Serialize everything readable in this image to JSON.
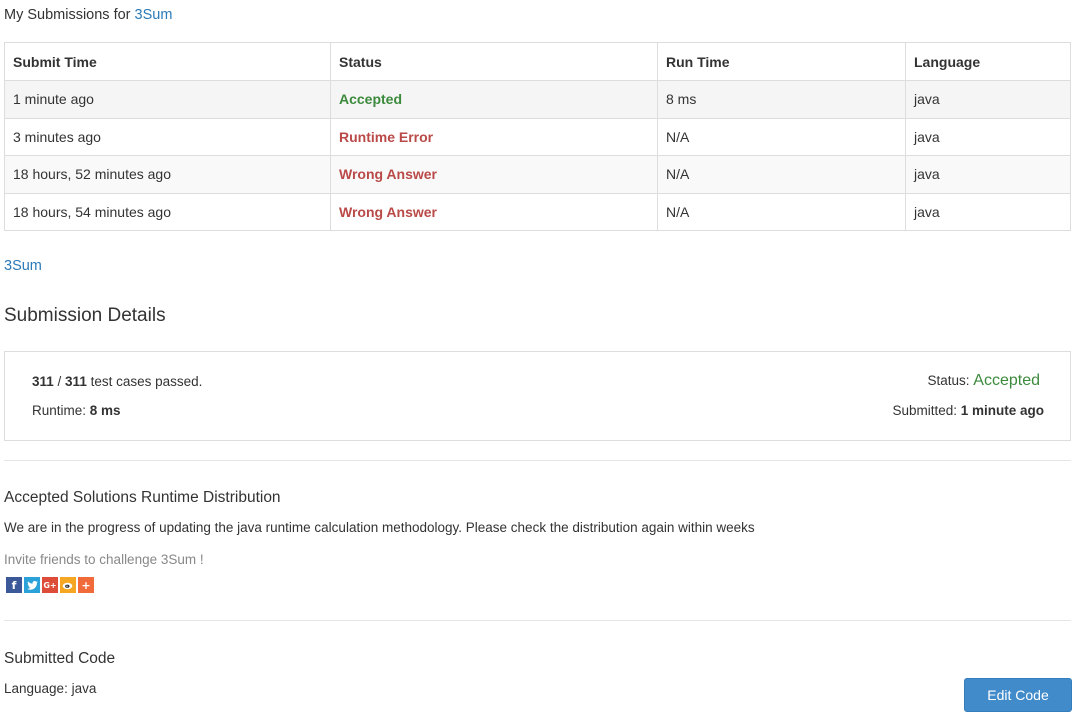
{
  "header": {
    "prefix": "My Submissions for ",
    "problem_link": "3Sum"
  },
  "submissions": {
    "columns": [
      "Submit Time",
      "Status",
      "Run Time",
      "Language"
    ],
    "rows": [
      {
        "time": "1 minute ago",
        "status": "Accepted",
        "runtime": "8 ms",
        "language": "java"
      },
      {
        "time": "3 minutes ago",
        "status": "Runtime Error",
        "runtime": "N/A",
        "language": "java"
      },
      {
        "time": "18 hours, 52 minutes ago",
        "status": "Wrong Answer",
        "runtime": "N/A",
        "language": "java"
      },
      {
        "time": "18 hours, 54 minutes ago",
        "status": "Wrong Answer",
        "runtime": "N/A",
        "language": "java"
      }
    ]
  },
  "problem_link": "3Sum",
  "details": {
    "title": "Submission Details",
    "passed": "311",
    "total": "311",
    "cases_text": " test cases passed.",
    "runtime_label": "Runtime: ",
    "runtime_value": "8 ms",
    "status_label": "Status: ",
    "status_value": "Accepted",
    "submitted_label": "Submitted: ",
    "submitted_value": "1 minute ago"
  },
  "distribution": {
    "title": "Accepted Solutions Runtime Distribution",
    "note": "We are in the progress of updating the java runtime calculation methodology. Please check the distribution again within weeks",
    "invite": "Invite friends to challenge 3Sum !",
    "share_icons": [
      "facebook-icon",
      "twitter-icon",
      "google-plus-icon",
      "weibo-icon",
      "add-share-icon"
    ]
  },
  "code": {
    "title": "Submitted Code",
    "language": "Language: java",
    "edit_button": "Edit Code"
  },
  "colors": {
    "link": "#2a7ab8",
    "accepted": "#3c8a3c",
    "error": "#b94a48",
    "button": "#428bca"
  }
}
